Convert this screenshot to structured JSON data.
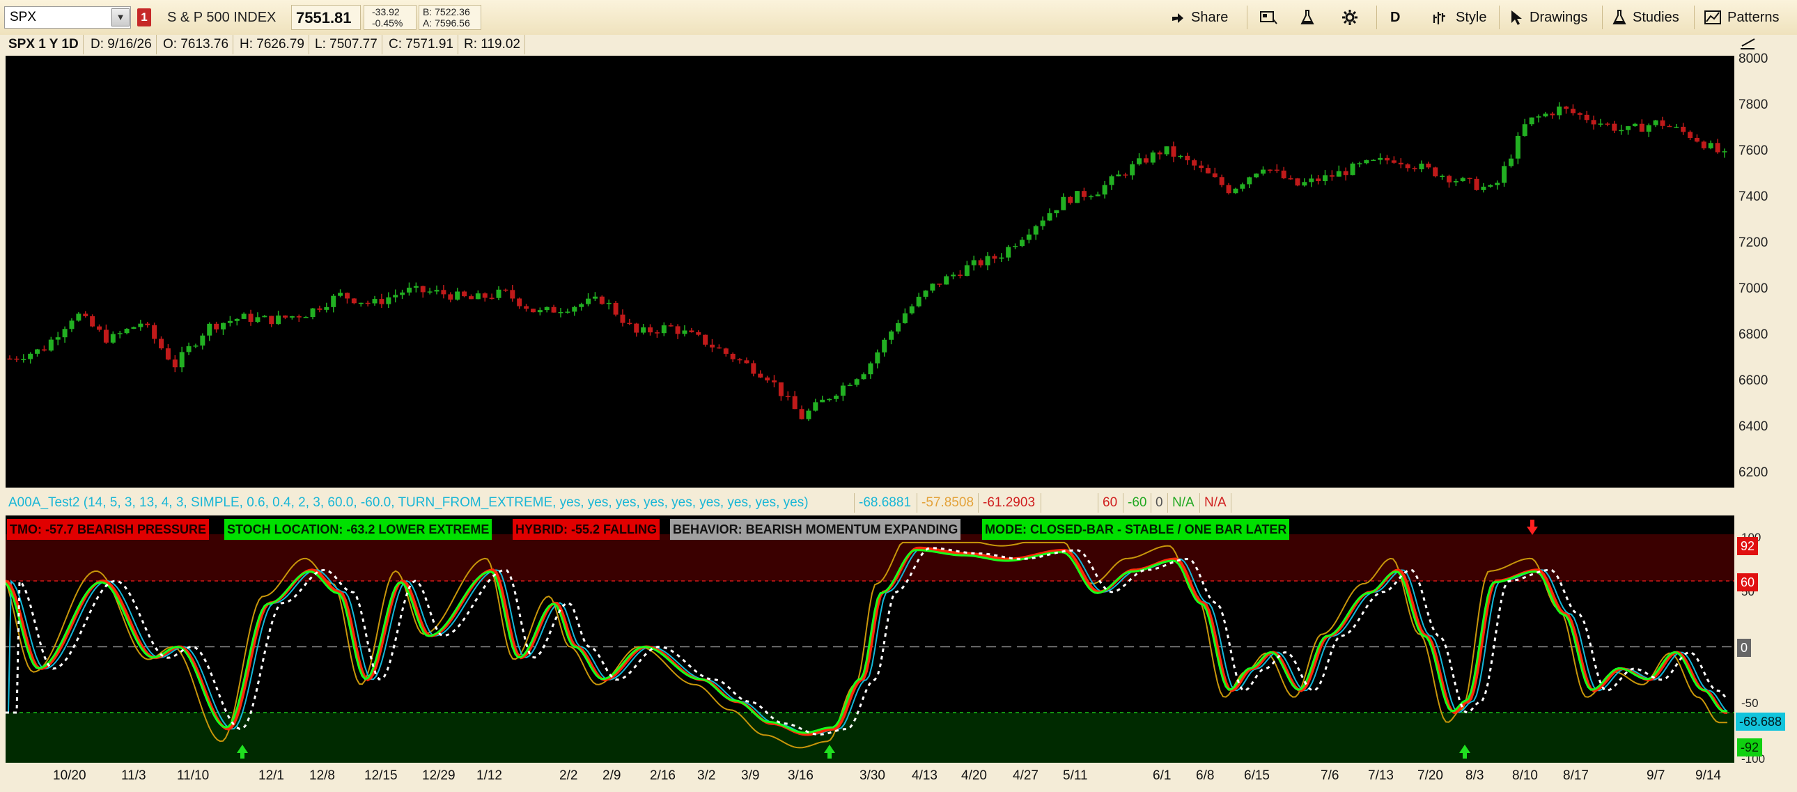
{
  "toolbar": {
    "symbol": "SPX",
    "alert_icon": "1",
    "index_name": "S & P 500 INDEX",
    "last_price": "7551.81",
    "net_change": "-33.92",
    "pct_change": "-0.45%",
    "bid": "B: 7522.36",
    "ask": "A: 7596.56",
    "share_label": "Share",
    "timeframe_label": "D",
    "style_label": "Style",
    "drawings_label": "Drawings",
    "studies_label": "Studies",
    "patterns_label": "Patterns"
  },
  "infobar": {
    "title": "SPX 1 Y 1D",
    "date": "D: 9/16/26",
    "open": "O: 7613.76",
    "high": "H: 7626.79",
    "low": "L: 7507.77",
    "close": "C: 7571.91",
    "range": "R: 119.02"
  },
  "price_axis": [
    "8000",
    "7800",
    "7600",
    "7400",
    "7200",
    "7000",
    "6800",
    "6600",
    "6400",
    "6200"
  ],
  "study": {
    "name": "A00A_Test2 (14, 5, 3, 13, 4, 3, SIMPLE, 0.6, 0.4, 2, 3, 60.0, -60.0, TURN_FROM_EXTREME, yes, yes, yes, yes, yes, yes, yes, yes, yes)",
    "v1": "-68.6881",
    "v2": "-57.8508",
    "v3": "-61.2903",
    "v4": "60",
    "v5": "-60",
    "v6": "0",
    "v7": "N/A",
    "v8": "N/A"
  },
  "tags": {
    "tmo": "TMO: -57.7 BEARISH PRESSURE",
    "stoch": "STOCH LOCATION: -63.2 LOWER EXTREME",
    "hybrid": "HYBRID: -55.2 FALLING",
    "behavior": "BEHAVIOR: BEARISH MOMENTUM EXPANDING",
    "mode": "MODE: CLOSED-BAR - STABLE / ONE BAR LATER"
  },
  "osc_axis": {
    "t100": "100",
    "t50": "50",
    "t0": "0",
    "tm50": "-50",
    "tm100": "-100",
    "badge_92": "92",
    "badge_60": "60",
    "badge_0": "0",
    "badge_val": "-68.688",
    "badge_m92": "-92"
  },
  "dates": [
    "10/20",
    "11/3",
    "11/10",
    "12/1",
    "12/8",
    "12/15",
    "12/29",
    "1/12",
    "2/2",
    "2/9",
    "2/16",
    "3/2",
    "3/9",
    "3/16",
    "3/30",
    "4/13",
    "4/20",
    "4/27",
    "5/11",
    "6/1",
    "6/8",
    "6/15",
    "7/6",
    "7/13",
    "7/20",
    "8/3",
    "8/10",
    "8/17",
    "9/7",
    "9/14"
  ],
  "colors": {
    "up": "#22b022",
    "down": "#c01a1a",
    "upper_zone": "#3a0000",
    "lower_zone": "#002a00"
  },
  "chart_data": {
    "type": "line",
    "series": [
      {
        "values": [
          6680,
          6720,
          6880,
          6760,
          6840,
          6650,
          6820,
          6860,
          6850,
          6880,
          6960,
          6920,
          6980,
          6970,
          6940,
          6970,
          6880,
          6910,
          6940,
          6790,
          6820,
          6760,
          6680,
          6600,
          6420,
          6530,
          6640,
          6860,
          7000,
          7080,
          7130,
          7260,
          7380,
          7420,
          7520,
          7600,
          7520,
          7420,
          7530,
          7440,
          7480,
          7530,
          7560,
          7510,
          7460,
          7420,
          7720,
          7780,
          7730,
          7680,
          7720,
          7660,
          7570
        ]
      }
    ],
    "ylim": [
      6100,
      8000
    ]
  }
}
